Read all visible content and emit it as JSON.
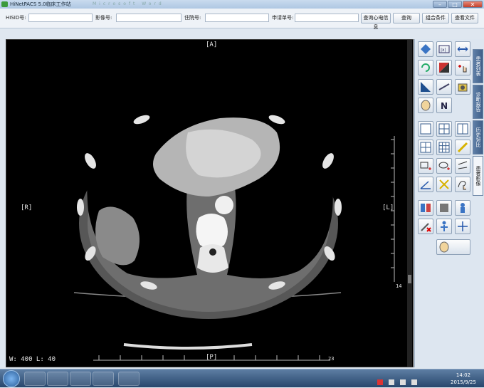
{
  "window": {
    "title": "HiNetPACS 5.0临床工作站",
    "ghost_title": "Microsoft Word"
  },
  "search": {
    "hisid_label": "HISID号:",
    "image_no_label": "影像号:",
    "inpatient_label": "住院号:",
    "request_no_label": "申请单号:",
    "ecg_query_btn": "查询心电信息",
    "query_btn": "查询",
    "combo_btn": "组合条件",
    "view_file_btn": "查看文件"
  },
  "viewer": {
    "top_marker": "[A]",
    "bottom_marker": "[P]",
    "left_marker": "[R]",
    "right_marker": "[L]",
    "window_level": "W: 400  L: 40",
    "scale_value": "14",
    "bottom_scale_value": "23"
  },
  "side_tabs": [
    "患者列表",
    "诊断报告",
    "历史对比",
    "患者影像"
  ],
  "taskbar": {
    "time": "14:02",
    "date": "2015/9/25"
  },
  "colors": {
    "accent": "#3f5f89",
    "viewer_bg": "#000000"
  }
}
